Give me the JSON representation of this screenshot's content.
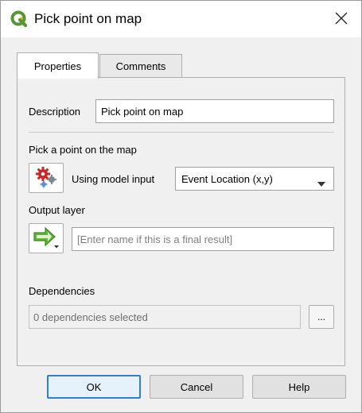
{
  "window": {
    "title": "Pick point on map",
    "icon": "qgis-logo-icon",
    "close_icon": "close-icon"
  },
  "tabs": [
    {
      "label": "Properties",
      "active": true
    },
    {
      "label": "Comments",
      "active": false
    }
  ],
  "properties": {
    "description_label": "Description",
    "description_value": "Pick point on map",
    "pick_point_label": "Pick a point on the map",
    "model_input_icon": "model-input-icon",
    "using_model_input_label": "Using model input",
    "model_input_selected": "Event Location (x,y)",
    "output_layer_label": "Output layer",
    "output_icon": "green-arrow-output-icon",
    "output_placeholder": "[Enter name if this is a final result]",
    "dependencies_label": "Dependencies",
    "dependencies_value": "0 dependencies selected",
    "dependencies_button": "..."
  },
  "footer": {
    "ok_label": "OK",
    "cancel_label": "Cancel",
    "help_label": "Help"
  },
  "colors": {
    "accent": "#2d7fd5",
    "qgis_green": "#589632",
    "qgis_yellow": "#eeb722",
    "output_arrow_green": "#5fb336",
    "model_input_red": "#c62828"
  }
}
